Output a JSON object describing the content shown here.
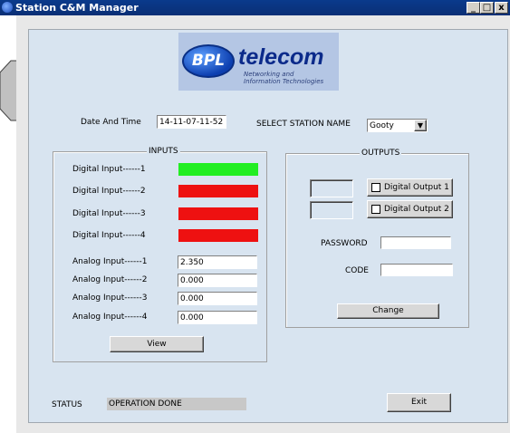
{
  "window": {
    "title": "Station C&M Manager",
    "controls": {
      "minimize": "_",
      "maximize": "□",
      "close": "x"
    }
  },
  "logo": {
    "badge": "BPL",
    "word": "telecom",
    "tagline_line1": "Networking  and",
    "tagline_line2": "Information Technologies"
  },
  "header": {
    "date_time_label": "Date And Time",
    "date_time_value": "14-11-07-11-52",
    "station_label": "SELECT STATION NAME",
    "station_value": "Gooty"
  },
  "inputs": {
    "legend": "INPUTS",
    "digital": [
      {
        "label": "Digital Input------1",
        "state": "on",
        "color": "#22ee22"
      },
      {
        "label": "Digital Input------2",
        "state": "off",
        "color": "#ee1111"
      },
      {
        "label": "Digital Input------3",
        "state": "off",
        "color": "#ee1111"
      },
      {
        "label": "Digital Input------4",
        "state": "off",
        "color": "#ee1111"
      }
    ],
    "analog": [
      {
        "label": "Analog Input------1",
        "value": "2.350"
      },
      {
        "label": "Analog Input------2",
        "value": "0.000"
      },
      {
        "label": "Analog Input------3",
        "value": "0.000"
      },
      {
        "label": "Analog Input------4",
        "value": "0.000"
      }
    ],
    "view_button": "View"
  },
  "outputs": {
    "legend": "OUTPUTS",
    "output1_label": "Digital Output 1",
    "output2_label": "Digital Output 2",
    "password_label": "PASSWORD",
    "password_value": "",
    "code_label": "CODE",
    "code_value": "",
    "change_button": "Change"
  },
  "status": {
    "label": "STATUS",
    "value": "OPERATION DONE"
  },
  "exit_button": "Exit",
  "colors": {
    "titlebar": "#0a3a8c",
    "panel": "#d8e4f0",
    "led_on": "#22ee22",
    "led_off": "#ee1111"
  }
}
